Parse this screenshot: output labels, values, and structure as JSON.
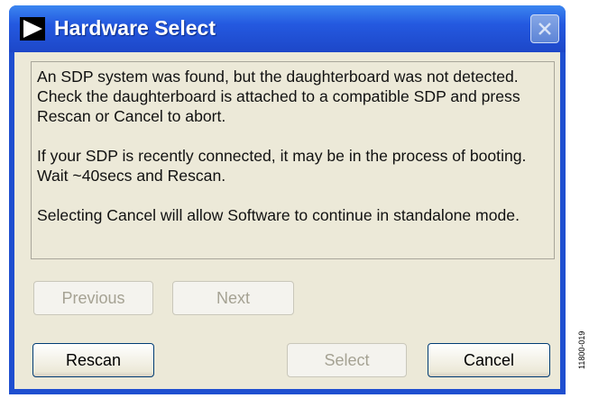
{
  "window": {
    "title": "Hardware Select"
  },
  "message": {
    "paragraph1": "An SDP system was found, but the daughterboard was not detected. Check the daughterboard is attached to a compatible SDP and press Rescan or Cancel to abort.",
    "paragraph2": "If your SDP is recently connected, it may be in the process of booting. Wait ~40secs and Rescan.",
    "paragraph3": "Selecting Cancel will allow Software to continue in standalone mode."
  },
  "buttons": {
    "previous": "Previous",
    "next": "Next",
    "rescan": "Rescan",
    "select": "Select",
    "cancel": "Cancel"
  },
  "figure_id": "11800-019"
}
